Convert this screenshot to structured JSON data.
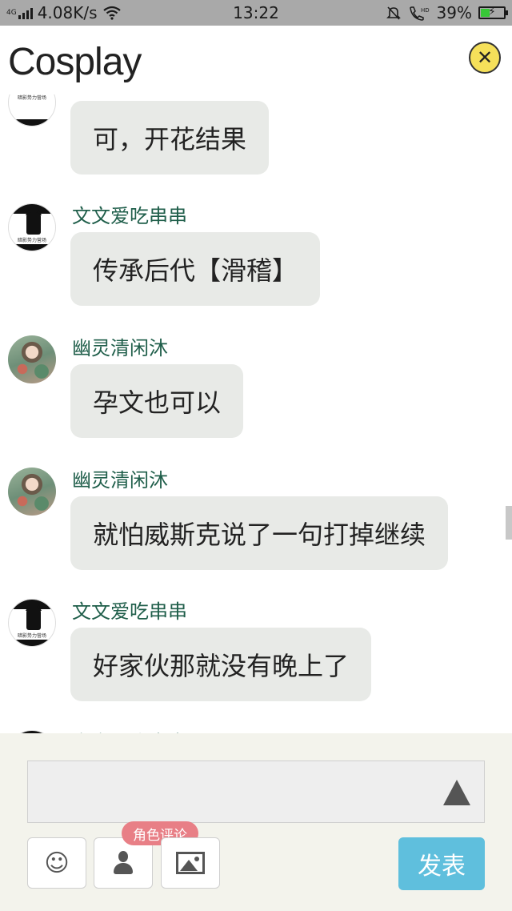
{
  "status_bar": {
    "network_label": "4G",
    "speed": "4.08K/s",
    "time": "13:22",
    "battery_percent": "39%",
    "icons": [
      "signal-icon",
      "wifi-icon",
      "mute-icon",
      "hd-call-icon",
      "battery-icon"
    ]
  },
  "header": {
    "title": "Cosplay",
    "close_symbol": "✕"
  },
  "messages": [
    {
      "username": "",
      "text": "可，开花结果",
      "avatar": "cat-avatar"
    },
    {
      "username": "文文爱吃串串",
      "text": "传承后代【滑稽】",
      "avatar": "cat-avatar"
    },
    {
      "username": "幽灵清闲沐",
      "text": "孕文也可以",
      "avatar": "girl-avatar"
    },
    {
      "username": "幽灵清闲沐",
      "text": "就怕威斯克说了一句打掉继续",
      "avatar": "girl-avatar"
    },
    {
      "username": "文文爱吃串串",
      "text": "好家伙那就没有晚上了",
      "avatar": "cat-avatar"
    },
    {
      "username": "文文爱吃串串",
      "text": "",
      "avatar": "cat-avatar"
    }
  ],
  "avatar_caption": "暗影势力营场",
  "composer": {
    "input_value": "",
    "emoji_symbol": "☺",
    "role_badge": "角色评论",
    "send_label": "发表"
  },
  "colors": {
    "status_bar": "#a9a9a9",
    "bubble": "#e8eae7",
    "username": "#1f5e4a",
    "composer_bg": "#f3f3ec",
    "send_button": "#5fbfdd",
    "badge": "#e87f86",
    "close_button": "#f5e05a"
  }
}
